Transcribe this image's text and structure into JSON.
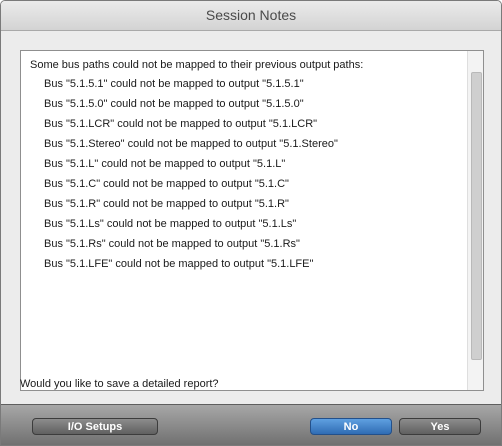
{
  "window": {
    "title": "Session Notes"
  },
  "notes": {
    "header": "Some bus paths could not be mapped to their previous output paths:",
    "lines": [
      "Bus \"5.1.5.1\" could not be mapped to output \"5.1.5.1\"",
      "Bus \"5.1.5.0\" could not be mapped to output \"5.1.5.0\"",
      "Bus \"5.1.LCR\" could not be mapped to output \"5.1.LCR\"",
      "Bus \"5.1.Stereo\" could not be mapped to output \"5.1.Stereo\"",
      "Bus \"5.1.L\" could not be mapped to output \"5.1.L\"",
      "Bus \"5.1.C\" could not be mapped to output \"5.1.C\"",
      "Bus \"5.1.R\" could not be mapped to output \"5.1.R\"",
      "Bus \"5.1.Ls\" could not be mapped to output \"5.1.Ls\"",
      "Bus \"5.1.Rs\" could not be mapped to output \"5.1.Rs\"",
      "Bus \"5.1.LFE\" could not be mapped to output \"5.1.LFE\""
    ]
  },
  "question": "Would you like to save a detailed report?",
  "buttons": {
    "io_setups": "I/O Setups",
    "no": "No",
    "yes": "Yes"
  },
  "colors": {
    "default_button": "#2f6cb4",
    "button_bar": "#8a8a8a"
  }
}
